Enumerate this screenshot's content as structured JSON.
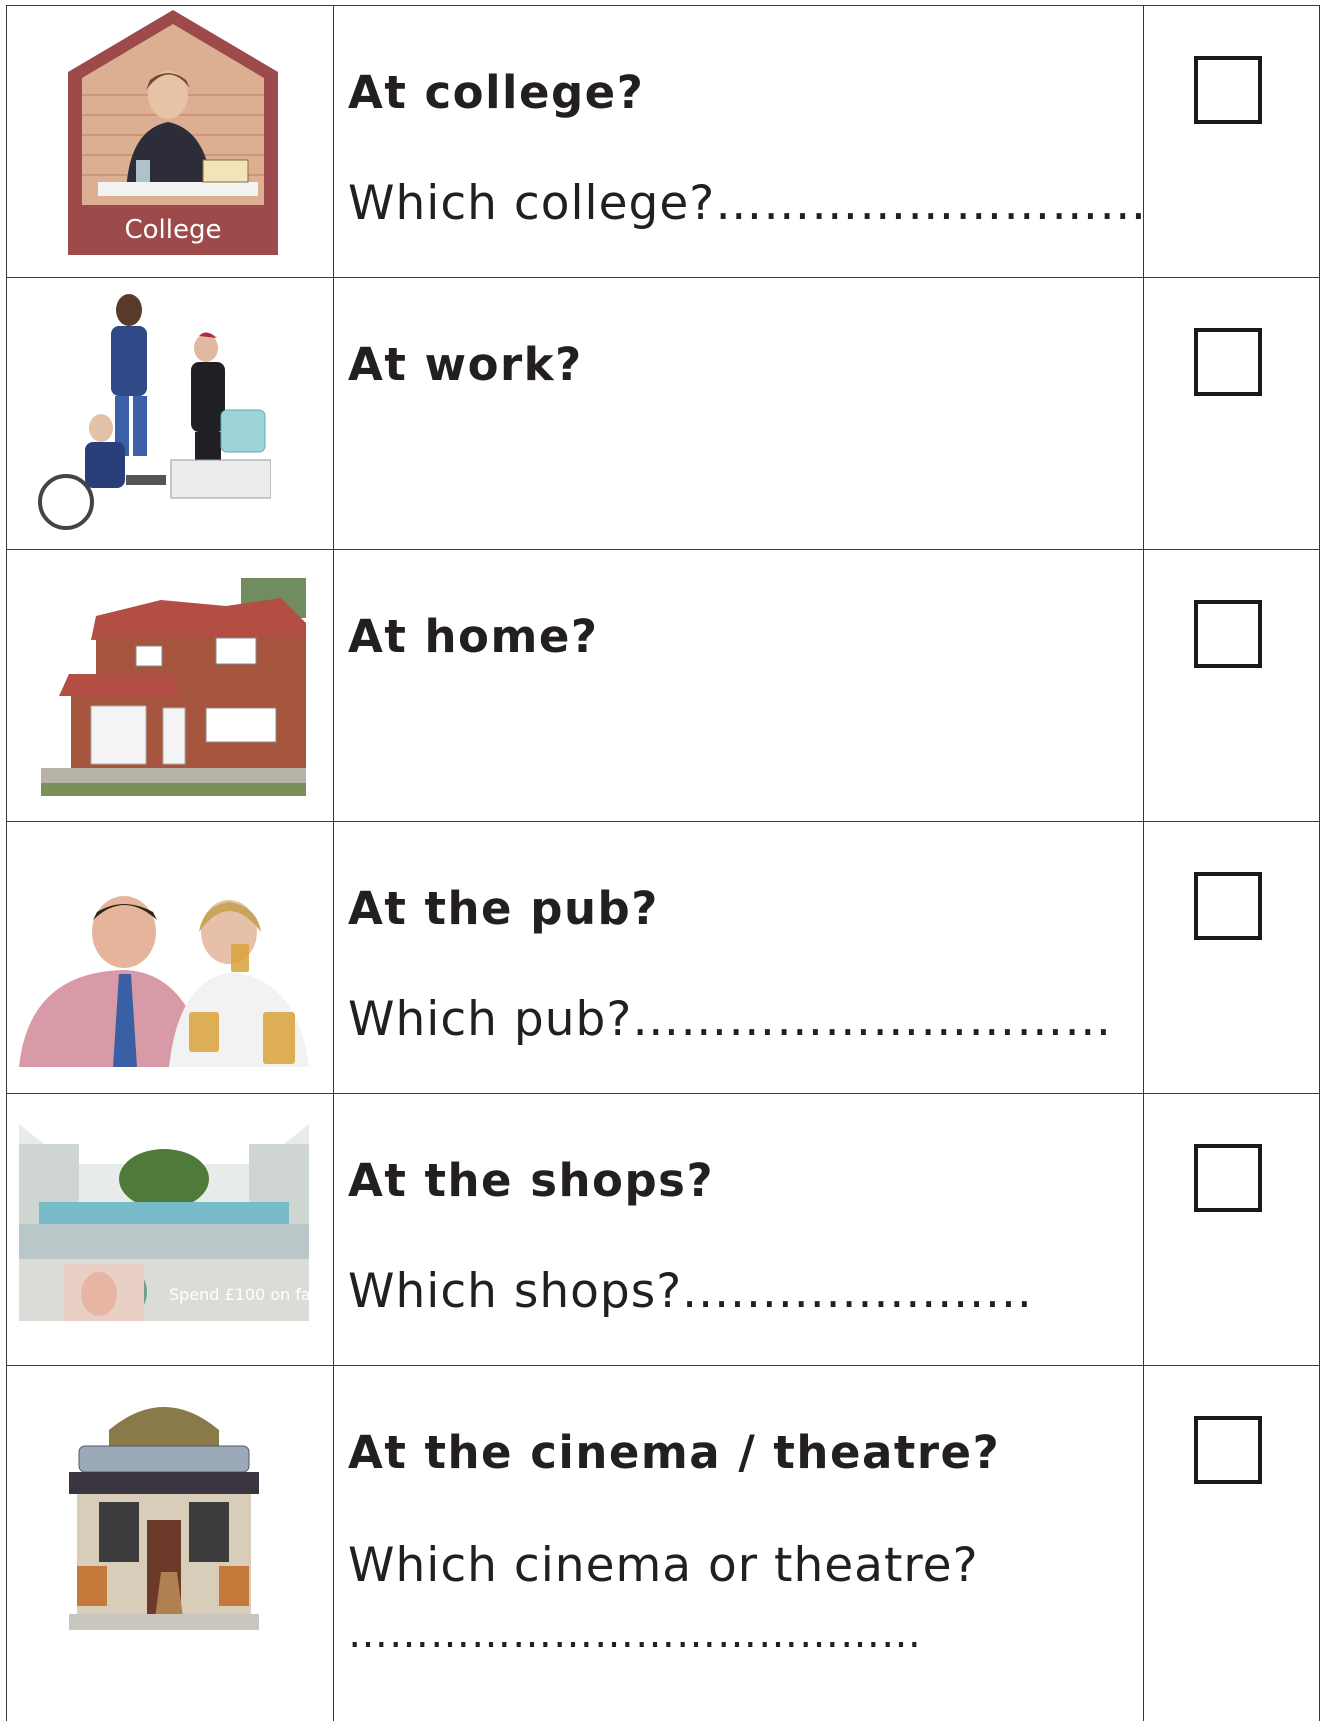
{
  "rows": [
    {
      "question": "At college?",
      "follow_up": "Which college?………………………",
      "picture": "college-picture",
      "picture_label": "College"
    },
    {
      "question": "At work?",
      "picture": "work-picture"
    },
    {
      "question": "At home?",
      "picture": "house-picture"
    },
    {
      "question": "At the pub?",
      "follow_up": "Which pub?…………………………",
      "picture": "pub-picture"
    },
    {
      "question": "At the shops?",
      "follow_up": "Which shops?......................",
      "picture": "shops-picture",
      "picture_caption": "Spend £100 on fas"
    },
    {
      "question": "At the cinema / theatre?",
      "follow_up": "Which cinema or theatre?",
      "follow_up_line": "……………………………………",
      "picture": "cinema-picture"
    }
  ],
  "colors": {
    "border": "#3a3a3a",
    "text": "#231f20",
    "college_frame": "#9c4a4a",
    "brick": "#d9a889"
  }
}
